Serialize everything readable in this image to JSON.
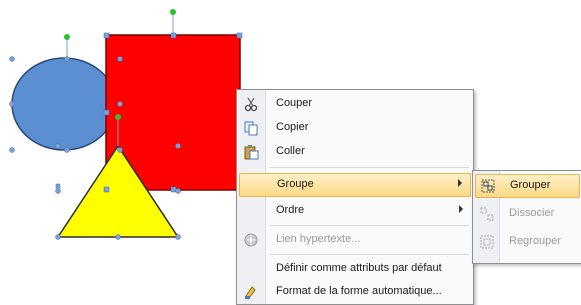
{
  "canvas": {
    "shapes": [
      {
        "name": "ellipse",
        "fill": "#5b8fd1"
      },
      {
        "name": "rectangle",
        "fill": "#ff0000"
      },
      {
        "name": "triangle",
        "fill": "#ffff00"
      }
    ],
    "handle_color": "#7aa2d8",
    "rotation_handle_color": "#2ec02e"
  },
  "menu": {
    "items": [
      {
        "label": "Couper",
        "icon": "scissors-icon",
        "disabled": false
      },
      {
        "label": "Copier",
        "icon": "copy-icon",
        "disabled": false
      },
      {
        "label": "Coller",
        "icon": "paste-icon",
        "disabled": false
      },
      {
        "label": "Groupe",
        "icon": "",
        "disabled": false,
        "submenu": true,
        "highlighted": true
      },
      {
        "label": "Ordre",
        "icon": "",
        "disabled": false,
        "submenu": true
      },
      {
        "label": "Lien hypertexte...",
        "icon": "hyperlink-icon",
        "disabled": true
      },
      {
        "label": "Définir comme attributs par défaut",
        "icon": "",
        "disabled": false
      },
      {
        "label": "Format de la forme automatique...",
        "icon": "format-shape-icon",
        "disabled": false
      }
    ]
  },
  "submenu": {
    "items": [
      {
        "label": "Grouper",
        "icon": "group-icon",
        "disabled": false,
        "highlighted": true
      },
      {
        "label": "Dissocier",
        "icon": "ungroup-icon",
        "disabled": true
      },
      {
        "label": "Regrouper",
        "icon": "regroup-icon",
        "disabled": true
      }
    ]
  },
  "colors": {
    "highlight_top": "#fff0c8",
    "highlight_bottom": "#fbd985",
    "highlight_border": "#e5b74c"
  }
}
